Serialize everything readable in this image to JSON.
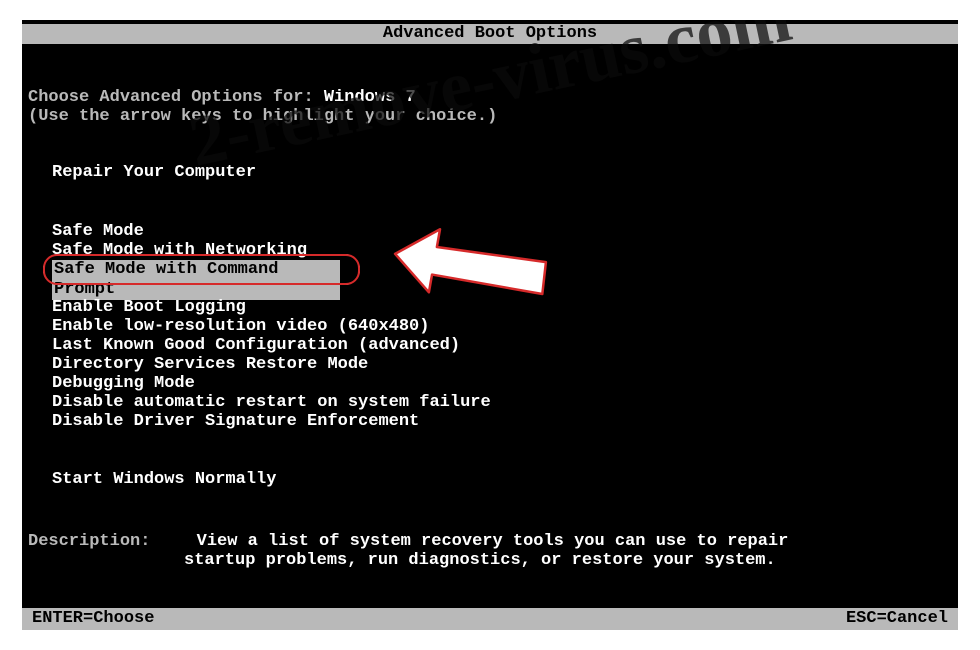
{
  "title": "Advanced Boot Options",
  "header_line1_prefix": "Choose Advanced Options for: ",
  "header_os": "Windows 7",
  "header_line2": "(Use the arrow keys to highlight your choice.)",
  "repair": "Repair Your Computer",
  "menu": {
    "safe": "Safe Mode",
    "safenet": "Safe Mode with Networking",
    "safecmd": "Safe Mode with Command Prompt",
    "ebl": "Enable Boot Logging",
    "elrv": "Enable low-resolution video (640x480)",
    "lkgc": "Last Known Good Configuration (advanced)",
    "dsrm": "Directory Services Restore Mode",
    "dbg": "Debugging Mode",
    "dar": "Disable automatic restart on system failure",
    "ddse": "Disable Driver Signature Enforcement",
    "start": "Start Windows Normally"
  },
  "desc_label": "Description:",
  "desc_line1": "View a list of system recovery tools you can use to repair",
  "desc_line2": "startup problems, run diagnostics, or restore your system.",
  "footer_left": "ENTER=Choose",
  "footer_right": "ESC=Cancel",
  "watermark": "2-remove-virus.com"
}
